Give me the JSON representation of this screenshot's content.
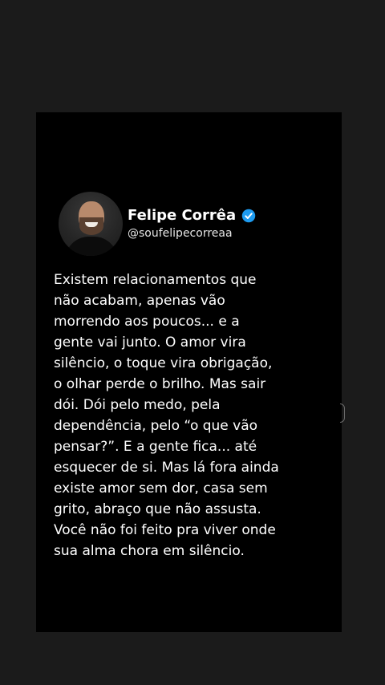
{
  "post": {
    "author_name": "Felipe Corrêa",
    "author_handle": "@soufelipecorreaa",
    "verified_icon": "verified-badge-icon",
    "text": "Existem relacionamentos que\nnão acabam, apenas vão\nmorrendo aos poucos... e a\ngente vai junto. O amor vira\nsilêncio, o toque vira obrigação,\no olhar perde o brilho. Mas sair\ndói. Dói pelo medo, pela\ndependência, pelo “o que vão\npensar?”. E a gente fica... até\nesquecer de si. Mas lá fora ainda\nexiste amor sem dor, casa sem\ngrito, abraço que não assusta.\nVocê não foi feito pra viver onde\nsua alma chora em silêncio."
  },
  "colors": {
    "background": "#1b1b1b",
    "card": "#000000",
    "text": "#ffffff",
    "verified": "#1d9bf0"
  }
}
